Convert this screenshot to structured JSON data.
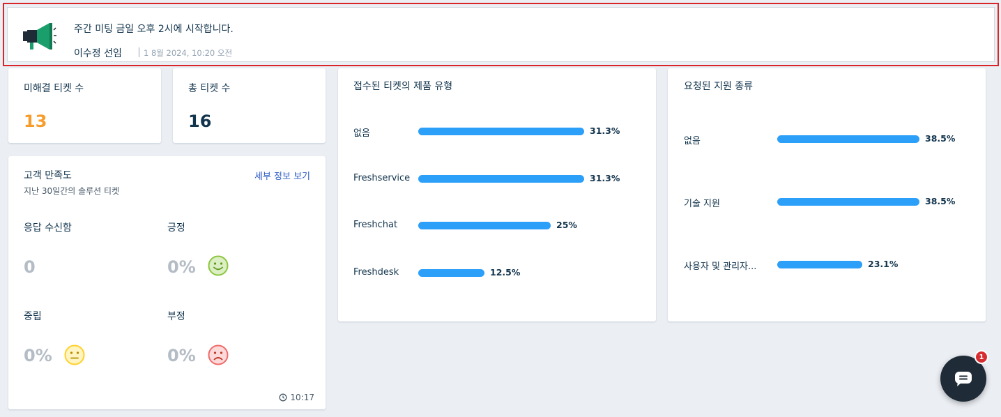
{
  "announcement": {
    "message": "주간 미팅 금일 오후 2시에 시작합니다.",
    "author": "이수정 선임",
    "time": "1 8월 2024, 10:20 오전"
  },
  "unresolved": {
    "title": "미해결 티켓 수",
    "value": "13",
    "color": "#f79c2a"
  },
  "total": {
    "title": "총 티켓 수",
    "value": "16"
  },
  "csat": {
    "title": "고객 만족도",
    "link": "세부 정보 보기",
    "subtitle": "지난 30일간의 솔루션 티켓",
    "responses_label": "응답 수신함",
    "responses_value": "0",
    "positive_label": "긍정",
    "positive_value": "0%",
    "neutral_label": "중립",
    "neutral_value": "0%",
    "negative_label": "부정",
    "negative_value": "0%",
    "updated": "10:17"
  },
  "product_types": {
    "title": "접수된 티켓의 제품 유형",
    "rows": [
      {
        "label": "없음",
        "pct": "31.3%",
        "value": 31.3
      },
      {
        "label": "Freshservice",
        "pct": "31.3%",
        "value": 31.3
      },
      {
        "label": "Freshchat",
        "pct": "25%",
        "value": 25
      },
      {
        "label": "Freshdesk",
        "pct": "12.5%",
        "value": 12.5
      }
    ]
  },
  "support_types": {
    "title": "요청된 지원 종류",
    "rows": [
      {
        "label": "없음",
        "pct": "38.5%",
        "value": 38.5
      },
      {
        "label": "기술 지원",
        "pct": "38.5%",
        "value": 38.5
      },
      {
        "label": "사용자 및 관리자...",
        "pct": "23.1%",
        "value": 23.1
      }
    ]
  },
  "chat": {
    "badge": "1"
  },
  "colors": {
    "bar": "#2c9ff9",
    "positive": "#8cc63f",
    "neutral": "#ffd12a",
    "negative": "#ef6b6b"
  }
}
